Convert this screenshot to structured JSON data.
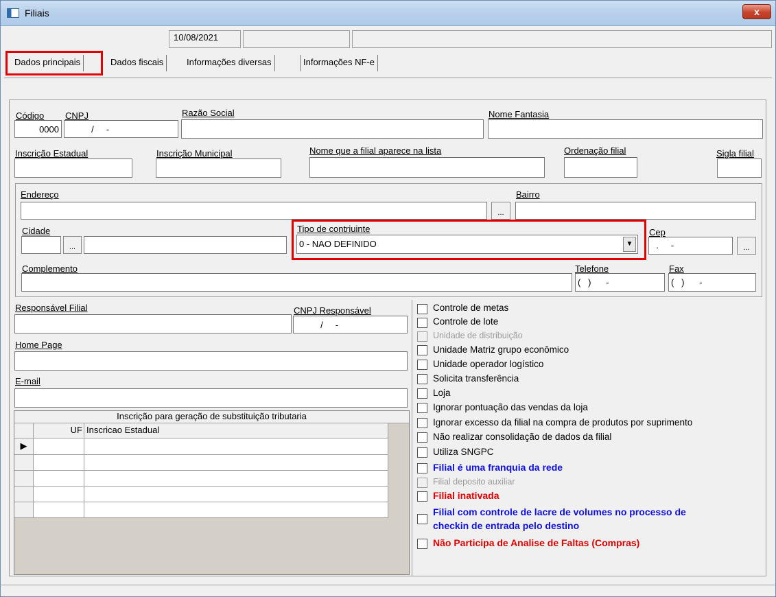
{
  "window": {
    "title": "Filiais",
    "close_label": "x",
    "app_icon": "form-icon"
  },
  "status": {
    "date": "10/08/2021",
    "field2": "",
    "field3": ""
  },
  "tabs": [
    {
      "label": "Dados principais",
      "active": true
    },
    {
      "label": "Dados fiscais"
    },
    {
      "label": "Informações diversas"
    },
    {
      "label": "Informações NF-e"
    }
  ],
  "fields": {
    "codigo": {
      "label": "Código",
      "value": "0000"
    },
    "cnpj": {
      "label": "CNPJ",
      "value": "          /     -"
    },
    "razao_social": {
      "label": "Razão Social",
      "value": ""
    },
    "nome_fantasia": {
      "label": "Nome Fantasia",
      "value": ""
    },
    "inscricao_estadual": {
      "label": "Inscrição Estadual",
      "value": ""
    },
    "inscricao_municipal": {
      "label": "Inscrição Municipal",
      "value": ""
    },
    "nome_lista": {
      "label": "Nome que a filial aparece na lista",
      "value": ""
    },
    "ordenacao": {
      "label": "Ordenação filial",
      "value": ""
    },
    "sigla": {
      "label": "Sigla filial",
      "value": ""
    },
    "endereco": {
      "label": "Endereço",
      "value": ""
    },
    "bairro": {
      "label": "Bairro",
      "value": ""
    },
    "cidade": {
      "label": "Cidade",
      "code": "",
      "name": ""
    },
    "tipo_contribuinte": {
      "label": "Tipo de contriuinte",
      "value": "0 - NAO DEFINIDO"
    },
    "cep": {
      "label": "Cep",
      "value": "  .     -"
    },
    "complemento": {
      "label": "Complemento",
      "value": ""
    },
    "telefone": {
      "label": "Telefone",
      "value": "(   )      -"
    },
    "fax": {
      "label": "Fax",
      "value": "(   )      -"
    },
    "responsavel": {
      "label": "Responsável Filial",
      "value": ""
    },
    "cnpj_responsavel": {
      "label": "CNPJ Responsável",
      "value": "          /     -"
    },
    "home_page": {
      "label": "Home Page",
      "value": ""
    },
    "email": {
      "label": "E-mail",
      "value": ""
    }
  },
  "buttons": {
    "dots": "..."
  },
  "grid": {
    "title": "Inscrição para geração de substituição tributaria",
    "columns": [
      "UF",
      "Inscricao Estadual"
    ],
    "current_row_marker": "▶"
  },
  "checkboxes": [
    {
      "label": "Controle de metas",
      "style": "normal"
    },
    {
      "label": "Controle de lote",
      "style": "normal"
    },
    {
      "label": "Unidade de distribuição",
      "style": "disabled"
    },
    {
      "label": "Unidade Matriz grupo econômico",
      "style": "normal"
    },
    {
      "label": "Unidade operador logístico",
      "style": "normal"
    },
    {
      "label": "Solicita transferência",
      "style": "normal"
    },
    {
      "label": "Loja",
      "style": "normal"
    },
    {
      "label": "Ignorar pontuação das vendas da loja",
      "style": "normal"
    },
    {
      "label": "Ignorar excesso da filial na compra de produtos por suprimento",
      "style": "normal"
    },
    {
      "label": "Não realizar consolidação de dados da filial",
      "style": "normal"
    },
    {
      "label": "Utiliza SNGPC",
      "style": "normal"
    },
    {
      "label": "Filial é uma franquia da rede",
      "style": "blue"
    },
    {
      "label": "Filial deposito auxiliar",
      "style": "disabled"
    },
    {
      "label": "Filial inativada",
      "style": "red"
    },
    {
      "label_line1": "Filial com controle de lacre de volumes no processo de",
      "label_line2": "checkin de entrada pelo destino",
      "style": "blue"
    },
    {
      "label": "Não Participa de Analise de Faltas (Compras)",
      "style": "red"
    }
  ],
  "colors": {
    "highlight": "#e00000",
    "blue_text": "#1010e0",
    "red_text": "#e00000"
  }
}
